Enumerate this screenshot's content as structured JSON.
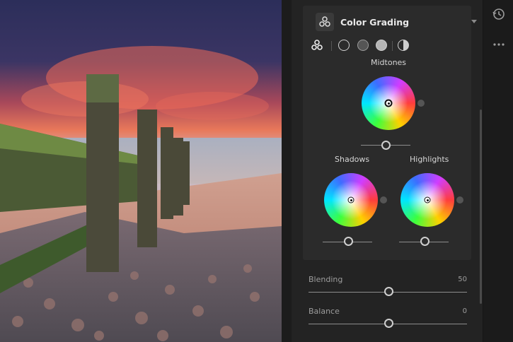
{
  "panel": {
    "title": "Color Grading",
    "modes": [
      "three-way-icon",
      "global-circle-icon",
      "dark-circle-icon",
      "light-circle-icon",
      "split-circle-icon"
    ],
    "wheels": {
      "midtones": {
        "label": "Midtones",
        "level": 0.5
      },
      "shadows": {
        "label": "Shadows",
        "level": 0.5
      },
      "highlights": {
        "label": "Highlights",
        "level": 0.5
      }
    },
    "sliders": {
      "blending": {
        "label": "Blending",
        "value": "50",
        "fraction": 0.5
      },
      "balance": {
        "label": "Balance",
        "value": "0",
        "fraction": 0.5
      }
    }
  },
  "rail": {
    "icons": [
      "history-icon",
      "more-icon"
    ]
  }
}
